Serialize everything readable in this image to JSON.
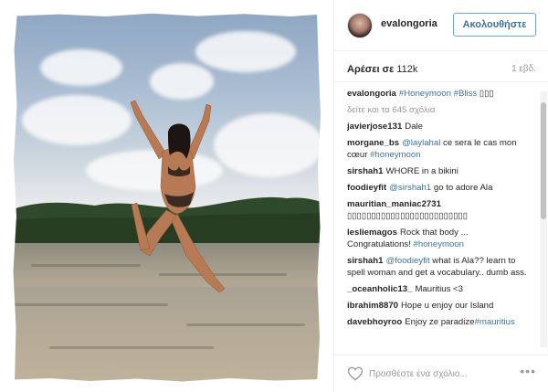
{
  "post": {
    "username": "evalongoria",
    "follow_label": "Ακολουθήστε",
    "likes_label": "Αρέσει σε",
    "likes_count": "112k",
    "time": "1 εβδ."
  },
  "caption": {
    "user": "evalongoria",
    "text_parts": [
      "#Honeymoon",
      "#Bliss",
      "▯▯▯"
    ],
    "view_all": "δείτε και τα 645 σχόλια"
  },
  "comments": [
    {
      "user": "javierjose131",
      "text": "Dale",
      "tag": ""
    },
    {
      "user": "morgane_bs",
      "tag": "@laylahal",
      "text": "ce sera le cas mon cœur",
      "tag2": "#honeymoon"
    },
    {
      "user": "sirshah1",
      "text": "WHORE in a bikini",
      "tag": ""
    },
    {
      "user": "foodieyfit",
      "tag": "@sirshah1",
      "text": "go to adore Ala"
    },
    {
      "user": "mauritian_maniac2731",
      "text": "▯▯▯▯▯▯▯▯▯▯▯▯▯▯▯▯▯▯▯▯▯▯▯▯▯",
      "tag": ""
    },
    {
      "user": "lesliemagos",
      "text": "Rock that body ... Congratulations!",
      "tag2": "#honeymoon"
    },
    {
      "user": "sirshah1",
      "tag": "@foodieyfit",
      "text": "what is Ala?? learn to spell woman and get a vocabulary.. dumb ass."
    },
    {
      "user": "_oceanholic13_",
      "text": "Mauritius <3",
      "tag": ""
    },
    {
      "user": "ibrahim8870",
      "text": "Hope u enjoy our Island",
      "tag": ""
    },
    {
      "user": "davebhoyroo",
      "text": "Enjoy ze paradize",
      "tag2": "#mauritius"
    }
  ],
  "add_comment": {
    "placeholder": "Προσθέστε ένα σχόλιο...",
    "more_label": "•••"
  },
  "icons": {
    "heart": "heart-icon",
    "more": "more-options-icon"
  },
  "colors": {
    "link": "#3f729b",
    "follow_border": "#70a3d8",
    "muted": "#999999"
  }
}
